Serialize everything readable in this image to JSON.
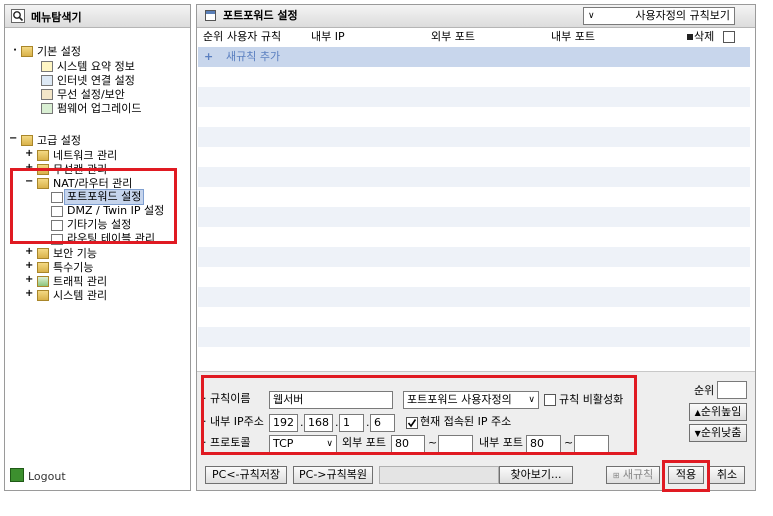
{
  "left_panel": {
    "title": "메뉴탐색기",
    "logout": "Logout",
    "basic": {
      "label": "기본 설정",
      "items": [
        "시스템 요약 정보",
        "인터넷 연결 설정",
        "무선 설정/보안",
        "펌웨어 업그레이드"
      ]
    },
    "advanced": {
      "label": "고급 설정",
      "items": [
        "네트워크 관리",
        "무선랜 관리",
        "NAT/라우터 관리",
        "보안 기능",
        "특수기능",
        "트래픽 관리",
        "시스템 관리"
      ],
      "nat_children": [
        "포트포워드 설정",
        "DMZ / Twin IP 설정",
        "기타기능 설정",
        "라우팅 테이블 관리"
      ]
    }
  },
  "right_panel": {
    "title": "포트포워드 설정",
    "view_select": "사용자정의 규칙보기",
    "columns": [
      "순위",
      "사용자 규칙",
      "내부 IP",
      "외부 포트",
      "내부 포트",
      "삭제"
    ],
    "add_rule": "새규칙 추가",
    "form": {
      "rule_name_label": "규칙이름",
      "rule_name_value": "웹서버",
      "rule_type": "포트포워드 사용자정의",
      "disable_label": "규칙 비활성화",
      "internal_ip_label": "내부 IP주소",
      "ip": [
        "192",
        "168",
        "1",
        "6"
      ],
      "current_ip_label": "현재 접속된 IP 주소",
      "protocol_label": "프로토콜",
      "protocol_value": "TCP",
      "ext_port_label": "외부 포트",
      "ext_port_from": "80",
      "ext_port_to": "",
      "int_port_label": "내부 포트",
      "int_port_from": "80",
      "int_port_to": "",
      "tilde": "~"
    },
    "rank": {
      "label": "순위",
      "value": "",
      "up": "순위높임",
      "down": "순위낮춤"
    },
    "bottom_buttons": {
      "save": "PC<-규칙저장",
      "restore": "PC->규칙복원",
      "browse": "찾아보기...",
      "new_rule": "새규칙",
      "apply": "적용",
      "cancel": "취소"
    }
  },
  "colors": {
    "highlight_red": "#e01a22",
    "add_row_bg": "#c8d6ec",
    "stripe_bg": "#eef2f8",
    "selected_bg": "#c5d4ec"
  }
}
